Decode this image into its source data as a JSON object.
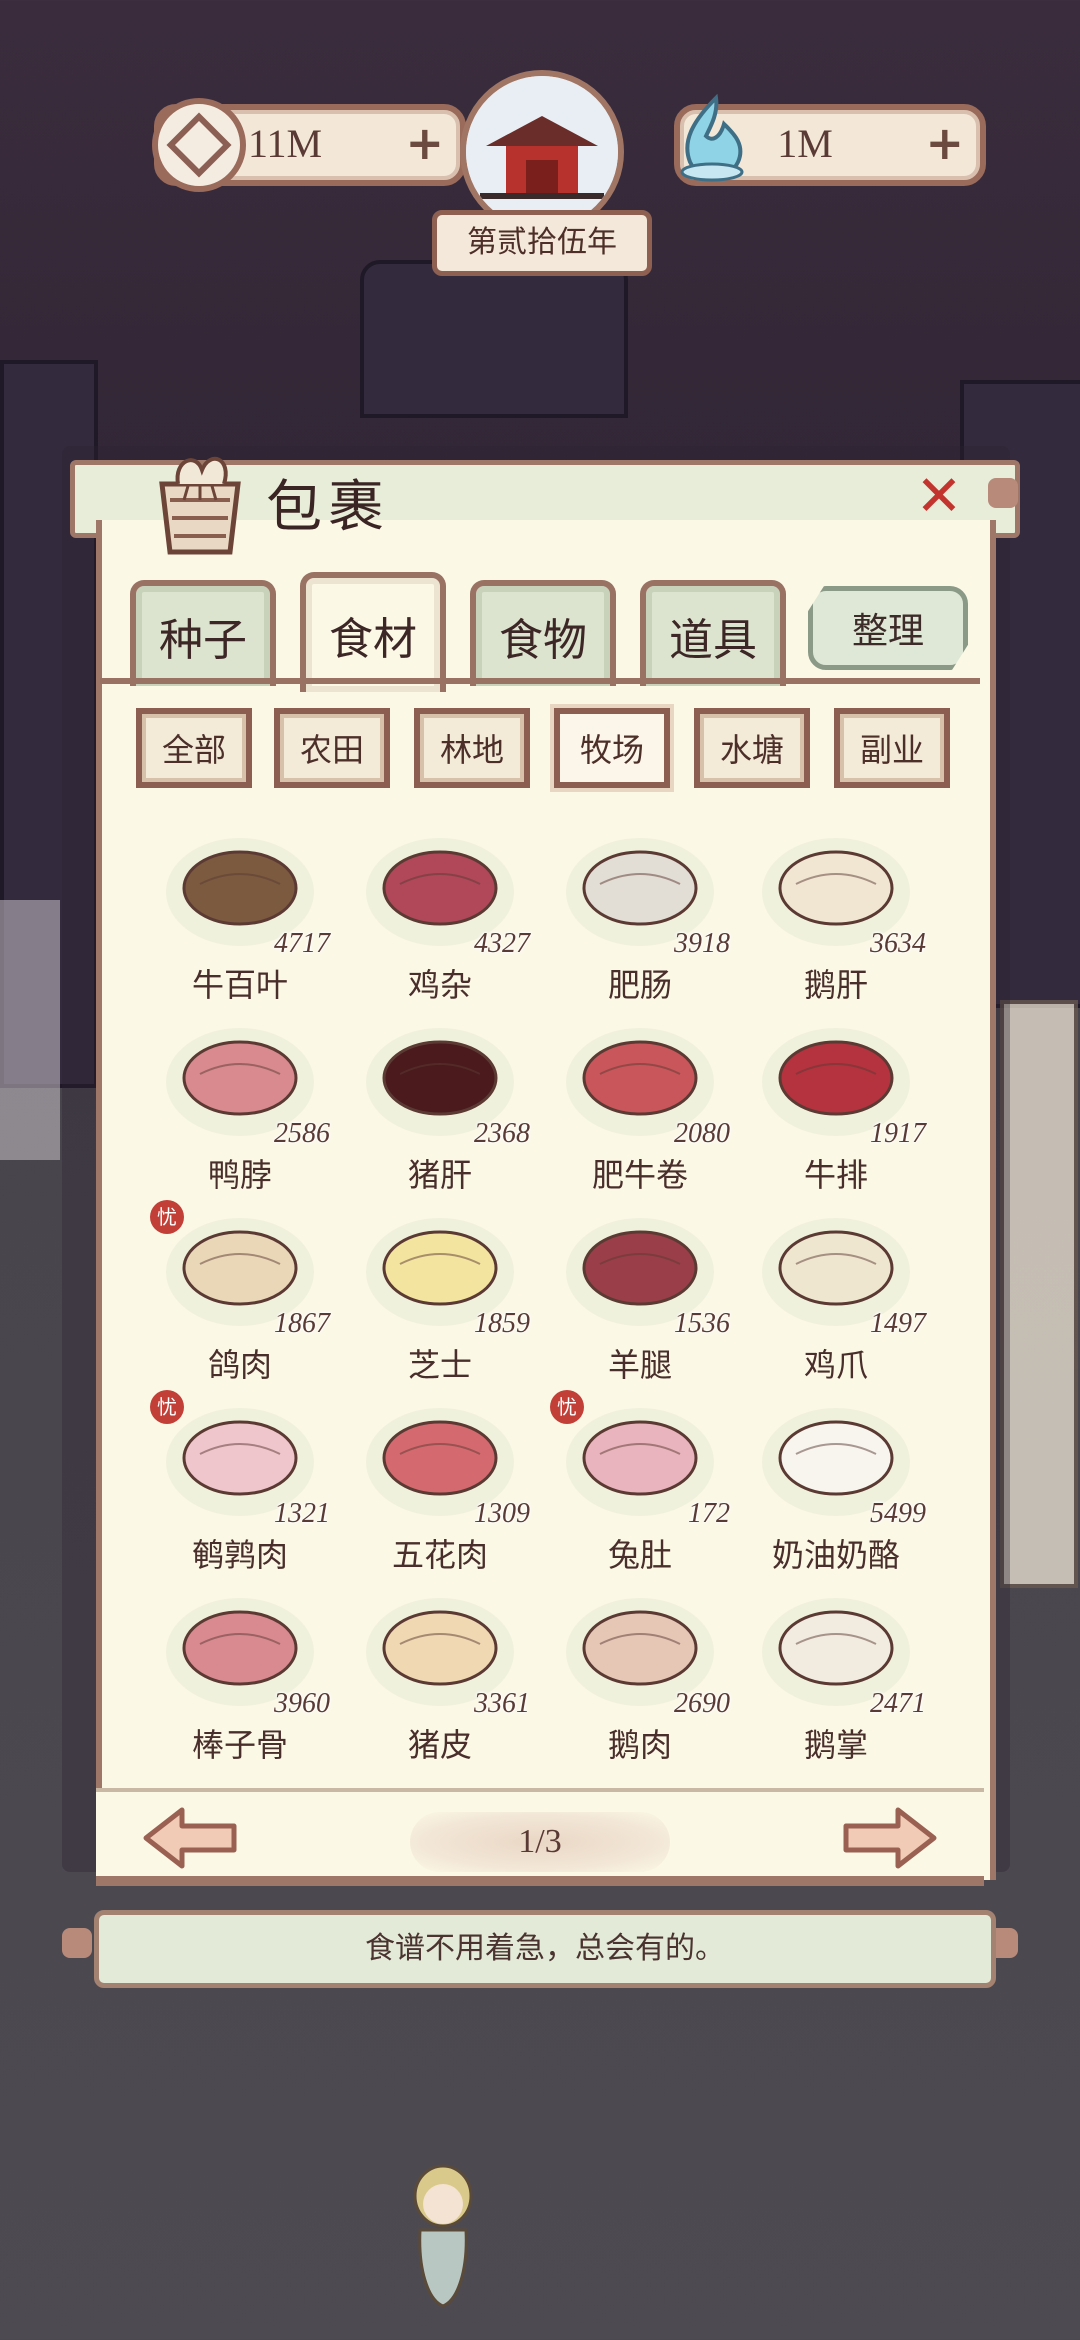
{
  "hud": {
    "coins": "11M",
    "spirit": "1M",
    "plus": "+",
    "year": "第贰拾伍年"
  },
  "panel": {
    "title": "包裹",
    "close": "✕"
  },
  "tabs": [
    {
      "label": "种子",
      "active": false
    },
    {
      "label": "食材",
      "active": true
    },
    {
      "label": "食物",
      "active": false
    },
    {
      "label": "道具",
      "active": false
    }
  ],
  "sort_label": "整理",
  "filters": [
    {
      "label": "全部",
      "active": false
    },
    {
      "label": "农田",
      "active": false
    },
    {
      "label": "林地",
      "active": false
    },
    {
      "label": "牧场",
      "active": true
    },
    {
      "label": "水塘",
      "active": false
    },
    {
      "label": "副业",
      "active": false
    }
  ],
  "badge_text": "忧",
  "items": [
    {
      "name": "牛百叶",
      "count": "4717",
      "icon": "tripe-icon",
      "badge": false,
      "color": "#7b5a3f"
    },
    {
      "name": "鸡杂",
      "count": "4327",
      "icon": "chicken-giblets-icon",
      "badge": false,
      "color": "#b0485a"
    },
    {
      "name": "肥肠",
      "count": "3918",
      "icon": "intestine-icon",
      "badge": false,
      "color": "#e2ddd5"
    },
    {
      "name": "鹅肝",
      "count": "3634",
      "icon": "foie-gras-icon",
      "badge": false,
      "color": "#f1e6d2"
    },
    {
      "name": "鸭脖",
      "count": "2586",
      "icon": "duck-neck-icon",
      "badge": false,
      "color": "#d88a8e"
    },
    {
      "name": "猪肝",
      "count": "2368",
      "icon": "pig-liver-icon",
      "badge": false,
      "color": "#4a1a1c"
    },
    {
      "name": "肥牛卷",
      "count": "2080",
      "icon": "beef-roll-icon",
      "badge": false,
      "color": "#c9565a"
    },
    {
      "name": "牛排",
      "count": "1917",
      "icon": "steak-icon",
      "badge": false,
      "color": "#b4333f"
    },
    {
      "name": "鸽肉",
      "count": "1867",
      "icon": "pigeon-icon",
      "badge": true,
      "color": "#ead7b8"
    },
    {
      "name": "芝士",
      "count": "1859",
      "icon": "cheese-icon",
      "badge": false,
      "color": "#f3e4a0"
    },
    {
      "name": "羊腿",
      "count": "1536",
      "icon": "lamb-leg-icon",
      "badge": false,
      "color": "#9a3f49"
    },
    {
      "name": "鸡爪",
      "count": "1497",
      "icon": "chicken-feet-icon",
      "badge": false,
      "color": "#efe6cf"
    },
    {
      "name": "鹌鹑肉",
      "count": "1321",
      "icon": "quail-icon",
      "badge": true,
      "color": "#efc6cc"
    },
    {
      "name": "五花肉",
      "count": "1309",
      "icon": "pork-belly-icon",
      "badge": false,
      "color": "#d46a6f"
    },
    {
      "name": "兔肚",
      "count": "172",
      "icon": "rabbit-belly-icon",
      "badge": true,
      "color": "#e9b4bd"
    },
    {
      "name": "奶油奶酪",
      "count": "5499",
      "icon": "cream-cheese-icon",
      "badge": false,
      "color": "#f7f5ee"
    },
    {
      "name": "棒子骨",
      "count": "3960",
      "icon": "bone-icon",
      "badge": false,
      "color": "#d98a90"
    },
    {
      "name": "猪皮",
      "count": "3361",
      "icon": "pork-skin-icon",
      "badge": false,
      "color": "#f0d8b2"
    },
    {
      "name": "鹅肉",
      "count": "2690",
      "icon": "goose-meat-icon",
      "badge": false,
      "color": "#e6c7b6"
    },
    {
      "name": "鹅掌",
      "count": "2471",
      "icon": "goose-feet-icon",
      "badge": false,
      "color": "#f2ece0"
    }
  ],
  "pager": {
    "page": "1/3"
  },
  "hint": "食谱不用着急，总会有的。"
}
